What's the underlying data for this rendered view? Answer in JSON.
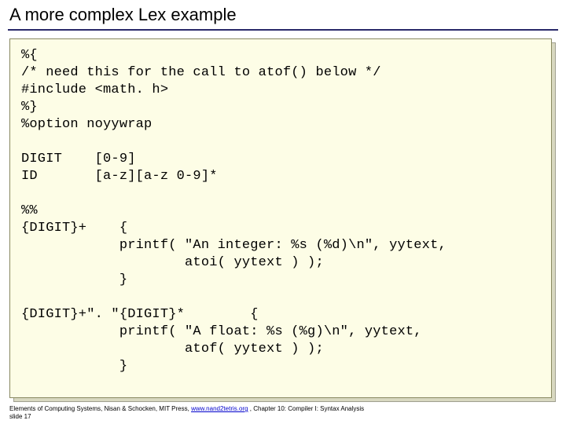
{
  "title": "A more complex Lex example",
  "code": "%{\n/* need this for the call to atof() below */\n#include <math. h>\n%}\n%option noyywrap\n\nDIGIT    [0-9]\nID       [a-z][a-z 0-9]*\n\n%%\n{DIGIT}+    {\n            printf( \"An integer: %s (%d)\\n\", yytext,\n                    atoi( yytext ) );\n            }\n\n{DIGIT}+\". \"{DIGIT}*        {\n            printf( \"A float: %s (%g)\\n\", yytext,\n                    atof( yytext ) );\n            }",
  "footer": {
    "pre": "Elements of Computing Systems, Nisan & Schocken, MIT Press, ",
    "link": "www.nand2tetris.org",
    "post": " , Chapter 10: Compiler I: Syntax Analysis",
    "slide": "slide 17"
  }
}
